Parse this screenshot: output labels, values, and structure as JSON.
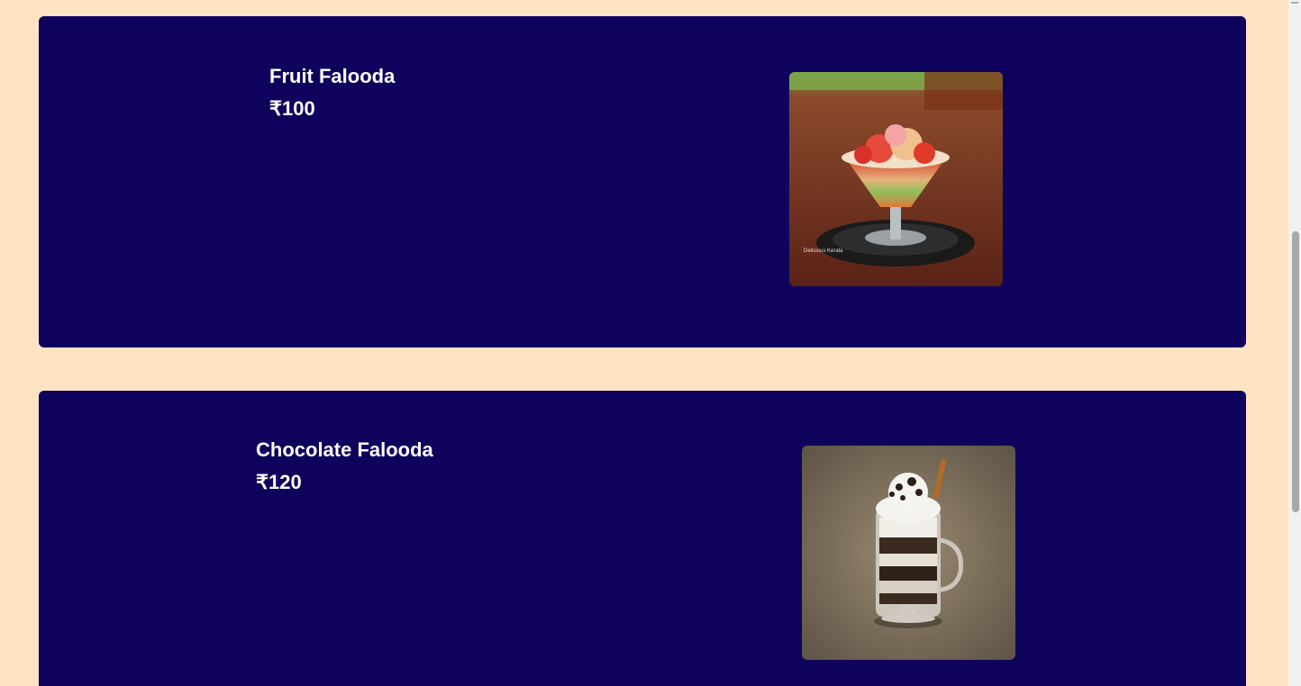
{
  "menu": {
    "items": [
      {
        "name": "Fruit Falooda",
        "price": "₹100",
        "image_icon": "fruit-falooda-photo",
        "image_caption": "Delicious Kerala"
      },
      {
        "name": "Chocolate Falooda",
        "price": "₹120",
        "image_icon": "chocolate-falooda-photo"
      }
    ]
  },
  "colors": {
    "page_background": "#ffe4c4",
    "card_background": "#0e025c",
    "text": "#ffffff"
  }
}
